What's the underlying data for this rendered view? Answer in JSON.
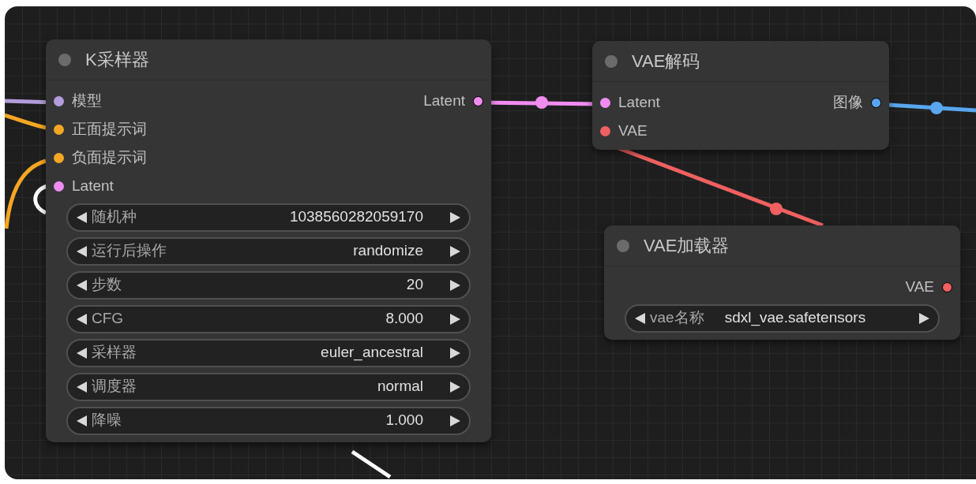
{
  "links": [
    {
      "color": "#b39ddb"
    },
    {
      "color": "#f5a623"
    },
    {
      "color": "#f5a623"
    },
    {
      "color": "#ffffff"
    },
    {
      "color": "#f08cf0"
    },
    {
      "color": "#58a6ef"
    },
    {
      "color": "#f06060"
    },
    {
      "color": "#ffffff"
    }
  ],
  "nodes": [
    {
      "title": "K采样器",
      "inputs": [
        {
          "label": "模型",
          "color": "#b39ddb"
        },
        {
          "label": "正面提示词",
          "color": "#f5a623"
        },
        {
          "label": "负面提示词",
          "color": "#f5a623"
        },
        {
          "label": "Latent",
          "color": "#f08cf0"
        }
      ],
      "outputs": [
        {
          "label": "Latent",
          "color": "#f08cf0"
        }
      ],
      "widgets": [
        {
          "label": "随机种",
          "value": "1038560282059170"
        },
        {
          "label": "运行后操作",
          "value": "randomize"
        },
        {
          "label": "步数",
          "value": "20"
        },
        {
          "label": "CFG",
          "value": "8.000"
        },
        {
          "label": "采样器",
          "value": "euler_ancestral"
        },
        {
          "label": "调度器",
          "value": "normal"
        },
        {
          "label": "降噪",
          "value": "1.000"
        }
      ]
    },
    {
      "title": "VAE解码",
      "inputs": [
        {
          "label": "Latent",
          "color": "#f08cf0"
        },
        {
          "label": "VAE",
          "color": "#f06060"
        }
      ],
      "outputs": [
        {
          "label": "图像",
          "color": "#58a6ef"
        }
      ]
    },
    {
      "title": "VAE加载器",
      "outputs": [
        {
          "label": "VAE",
          "color": "#f06060"
        }
      ],
      "widgets": [
        {
          "label": "vae名称",
          "value": "sdxl_vae.safetensors"
        }
      ]
    }
  ]
}
